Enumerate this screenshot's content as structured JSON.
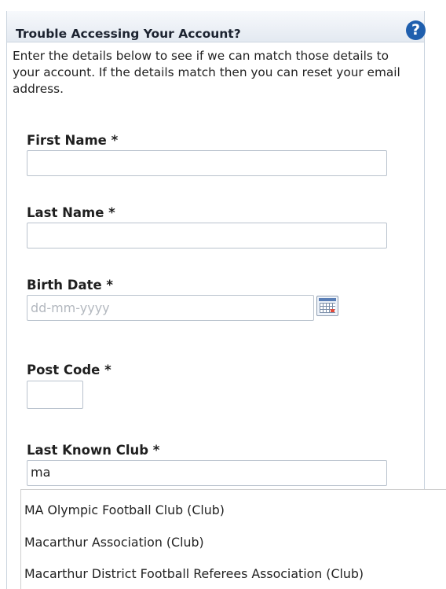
{
  "panel": {
    "title": "Trouble Accessing Your Account?",
    "help_icon": "help-circle-icon",
    "help_glyph": "?",
    "intro": "Enter the details below to see if we can match those details to your account. If the details match then you can reset your email address."
  },
  "fields": {
    "first_name": {
      "label": "First Name *",
      "value": ""
    },
    "last_name": {
      "label": "Last Name *",
      "value": ""
    },
    "birth_date": {
      "label": "Birth Date *",
      "value": "",
      "placeholder": "dd-mm-yyyy",
      "icon": "calendar-icon"
    },
    "post_code": {
      "label": "Post Code *",
      "value": ""
    },
    "last_club": {
      "label": "Last Known Club *",
      "value": "ma"
    }
  },
  "suggestions": [
    "MA Olympic Football Club (Club)",
    "Macarthur Association (Club)",
    "Macarthur District Football Referees Association (Club)"
  ],
  "colors": {
    "header_bg": "#e3e9f1",
    "accent": "#1f5fae",
    "border": "#b9c2cd"
  }
}
